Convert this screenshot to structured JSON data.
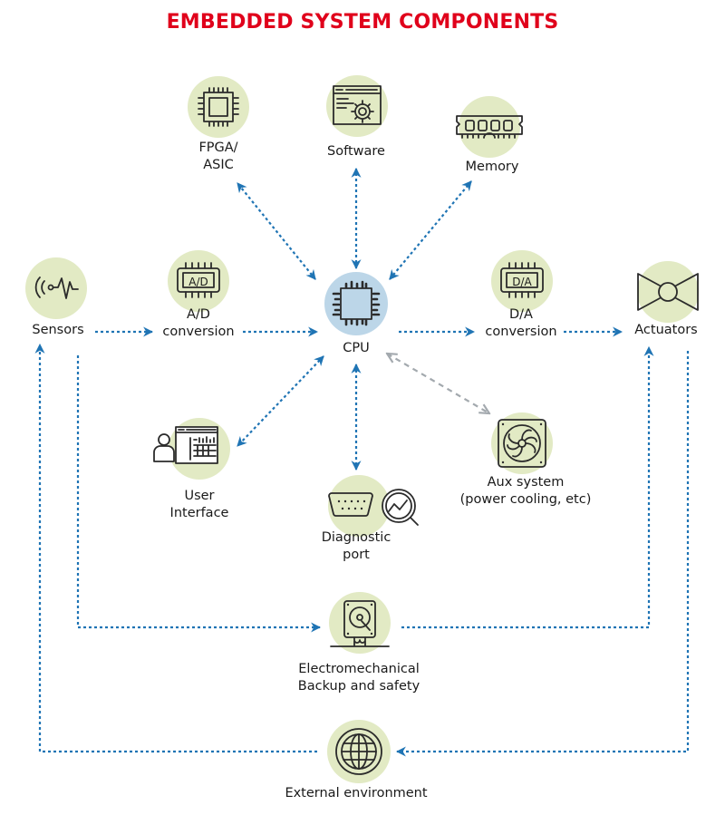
{
  "title": "EMBEDDED SYSTEM COMPONENTS",
  "colors": {
    "title": "#e0001b",
    "node_fill": "#e2eac4",
    "cpu_fill": "#bcd6e8",
    "arrow_blue": "#1f74b4",
    "arrow_gray": "#a3a9ae",
    "icon_stroke": "#2b2b2b"
  },
  "nodes": [
    {
      "id": "fpga",
      "label_lines": [
        "FPGA/",
        "ASIC"
      ],
      "icon": "chip-icon"
    },
    {
      "id": "software",
      "label_lines": [
        "Software"
      ],
      "icon": "software-gear-icon"
    },
    {
      "id": "memory",
      "label_lines": [
        "Memory"
      ],
      "icon": "memory-module-icon"
    },
    {
      "id": "sensors",
      "label_lines": [
        "Sensors"
      ],
      "icon": "sensor-wave-icon"
    },
    {
      "id": "ad",
      "label_lines": [
        "A/D",
        "conversion"
      ],
      "icon": "ad-converter-icon",
      "chip_text": "A/D"
    },
    {
      "id": "cpu",
      "label_lines": [
        "CPU"
      ],
      "icon": "cpu-icon"
    },
    {
      "id": "da",
      "label_lines": [
        "D/A",
        "conversion"
      ],
      "icon": "da-converter-icon",
      "chip_text": "D/A"
    },
    {
      "id": "actuators",
      "label_lines": [
        "Actuators"
      ],
      "icon": "valve-icon"
    },
    {
      "id": "ui",
      "label_lines": [
        "User",
        "Interface"
      ],
      "icon": "user-interface-icon"
    },
    {
      "id": "diag",
      "label_lines": [
        "Diagnostic",
        "port"
      ],
      "icon": "diagnostic-port-icon"
    },
    {
      "id": "aux",
      "label_lines": [
        "Aux system",
        "(power cooling, etc)"
      ],
      "icon": "fan-icon"
    },
    {
      "id": "backup",
      "label_lines": [
        "Electromechanical",
        "Backup and safety"
      ],
      "icon": "hard-drive-icon"
    },
    {
      "id": "external",
      "label_lines": [
        "External environment"
      ],
      "icon": "globe-icon"
    }
  ],
  "edges": [
    {
      "from": "cpu",
      "to": "fpga",
      "direction": "both",
      "style": "blue-dotted"
    },
    {
      "from": "cpu",
      "to": "software",
      "direction": "both",
      "style": "blue-dotted"
    },
    {
      "from": "cpu",
      "to": "memory",
      "direction": "both",
      "style": "blue-dotted"
    },
    {
      "from": "sensors",
      "to": "ad",
      "direction": "forward",
      "style": "blue-dotted"
    },
    {
      "from": "ad",
      "to": "cpu",
      "direction": "forward",
      "style": "blue-dotted"
    },
    {
      "from": "cpu",
      "to": "da",
      "direction": "forward",
      "style": "blue-dotted"
    },
    {
      "from": "da",
      "to": "actuators",
      "direction": "forward",
      "style": "blue-dotted"
    },
    {
      "from": "cpu",
      "to": "ui",
      "direction": "both",
      "style": "blue-dotted"
    },
    {
      "from": "cpu",
      "to": "diag",
      "direction": "both",
      "style": "blue-dotted"
    },
    {
      "from": "cpu",
      "to": "aux",
      "direction": "both",
      "style": "gray-dashed"
    },
    {
      "from": "sensors",
      "to": "backup",
      "direction": "forward",
      "style": "blue-dotted"
    },
    {
      "from": "backup",
      "to": "actuators",
      "direction": "forward",
      "style": "blue-dotted"
    },
    {
      "from": "actuators",
      "to": "external",
      "direction": "forward",
      "style": "blue-dotted"
    },
    {
      "from": "external",
      "to": "sensors",
      "direction": "forward",
      "style": "blue-dotted"
    }
  ]
}
